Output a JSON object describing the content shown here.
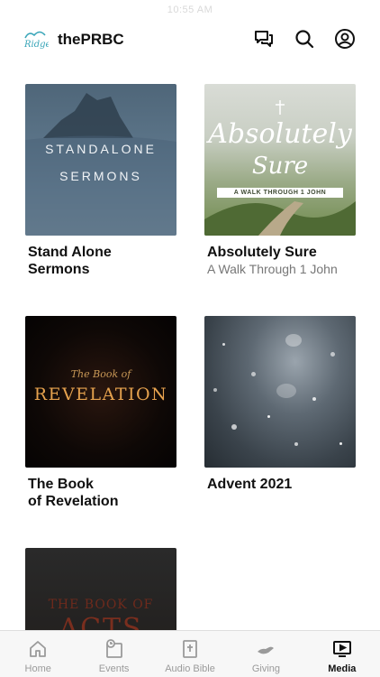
{
  "status_bar": {
    "time": "10:55 AM"
  },
  "header": {
    "app_title": "thePRBC",
    "logo_text": "Ridge",
    "icons": [
      "chat-icon",
      "search-icon",
      "profile-icon"
    ]
  },
  "media": {
    "items": [
      {
        "title": "Stand Alone\nSermons",
        "subtitle": "",
        "artwork": {
          "line1": "STANDALONE",
          "line2": "SERMONS"
        }
      },
      {
        "title": "Absolutely Sure",
        "subtitle": "A Walk Through 1 John",
        "artwork": {
          "line1": "Absolutely",
          "line2": "Sure",
          "band": "A WALK THROUGH 1 JOHN"
        }
      },
      {
        "title": "The Book\nof Revelation",
        "subtitle": "",
        "artwork": {
          "line1": "The Book of",
          "line2": "REVELATION"
        }
      },
      {
        "title": "Advent 2021",
        "subtitle": "",
        "artwork": {}
      },
      {
        "title": "",
        "subtitle": "",
        "artwork": {
          "line1": "THE BOOK OF",
          "line2": "ACTS"
        }
      }
    ]
  },
  "tab_bar": {
    "tabs": [
      {
        "label": "Home",
        "icon": "home-icon",
        "active": false
      },
      {
        "label": "Events",
        "icon": "events-icon",
        "active": false
      },
      {
        "label": "Audio Bible",
        "icon": "bible-icon",
        "active": false
      },
      {
        "label": "Giving",
        "icon": "giving-icon",
        "active": false
      },
      {
        "label": "Media",
        "icon": "media-icon",
        "active": true
      }
    ]
  },
  "colors": {
    "text": "#111111",
    "inactive_tab": "#9a9a9a",
    "logo_teal": "#3aa6b9"
  }
}
